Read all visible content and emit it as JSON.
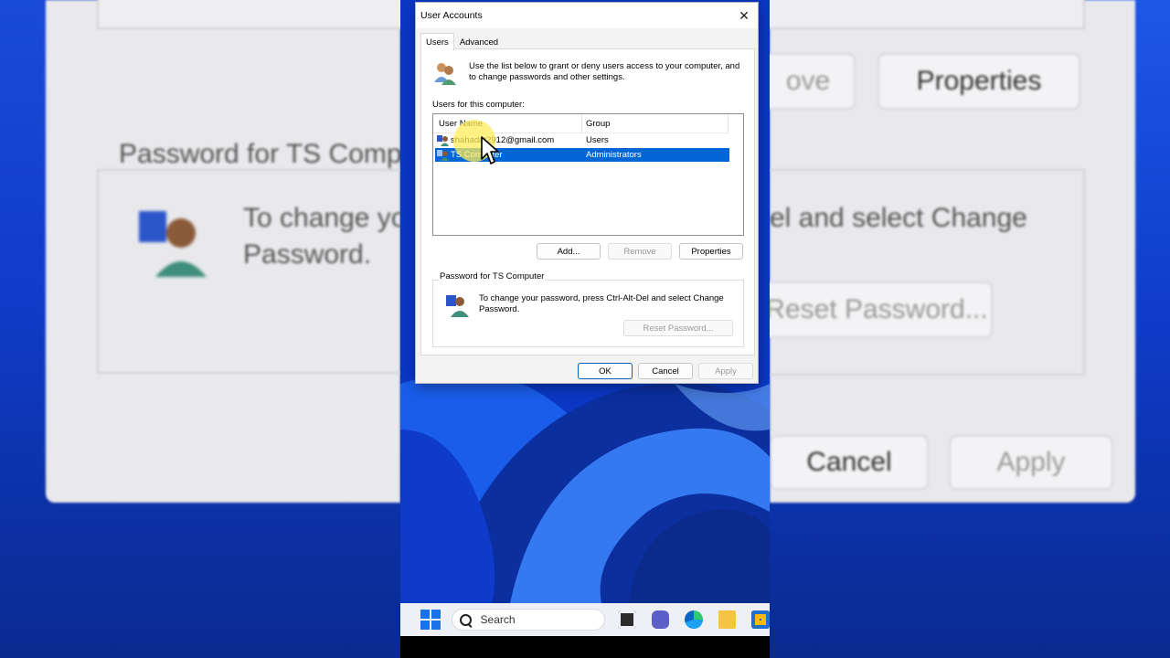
{
  "dialog": {
    "title": "User Accounts",
    "tabs": [
      "Users",
      "Advanced"
    ],
    "intro": "Use the list below to grant or deny users access to your computer, and to change passwords and other settings.",
    "users_label": "Users for this computer:",
    "columns": [
      "User Name",
      "Group"
    ],
    "rows": [
      {
        "name": "shahadat2912@gmail.com",
        "group": "Users",
        "selected": false
      },
      {
        "name": "TS Computer",
        "group": "Administrators",
        "selected": true
      }
    ],
    "buttons": {
      "add": "Add...",
      "remove": "Remove",
      "properties": "Properties"
    },
    "password_group": {
      "title": "Password for TS Computer",
      "text": "To change your password, press Ctrl-Alt-Del and select Change Password.",
      "reset": "Reset Password..."
    },
    "footer": {
      "ok": "OK",
      "cancel": "Cancel",
      "apply": "Apply"
    }
  },
  "taskbar": {
    "search_placeholder": "Search"
  },
  "background_left": {
    "group_title": "Password for TS Comp",
    "text_line1": "To change yo",
    "text_line2": "Password."
  },
  "background_right": {
    "properties": "Properties",
    "remove_fragment": "ove",
    "text_fragment": "el and select Change",
    "reset": "Reset Password...",
    "cancel": "Cancel",
    "apply": "Apply"
  },
  "colors": {
    "selection": "#0066d6",
    "wallpaper": "#0c3bcc",
    "accent": "#1a73e8"
  }
}
